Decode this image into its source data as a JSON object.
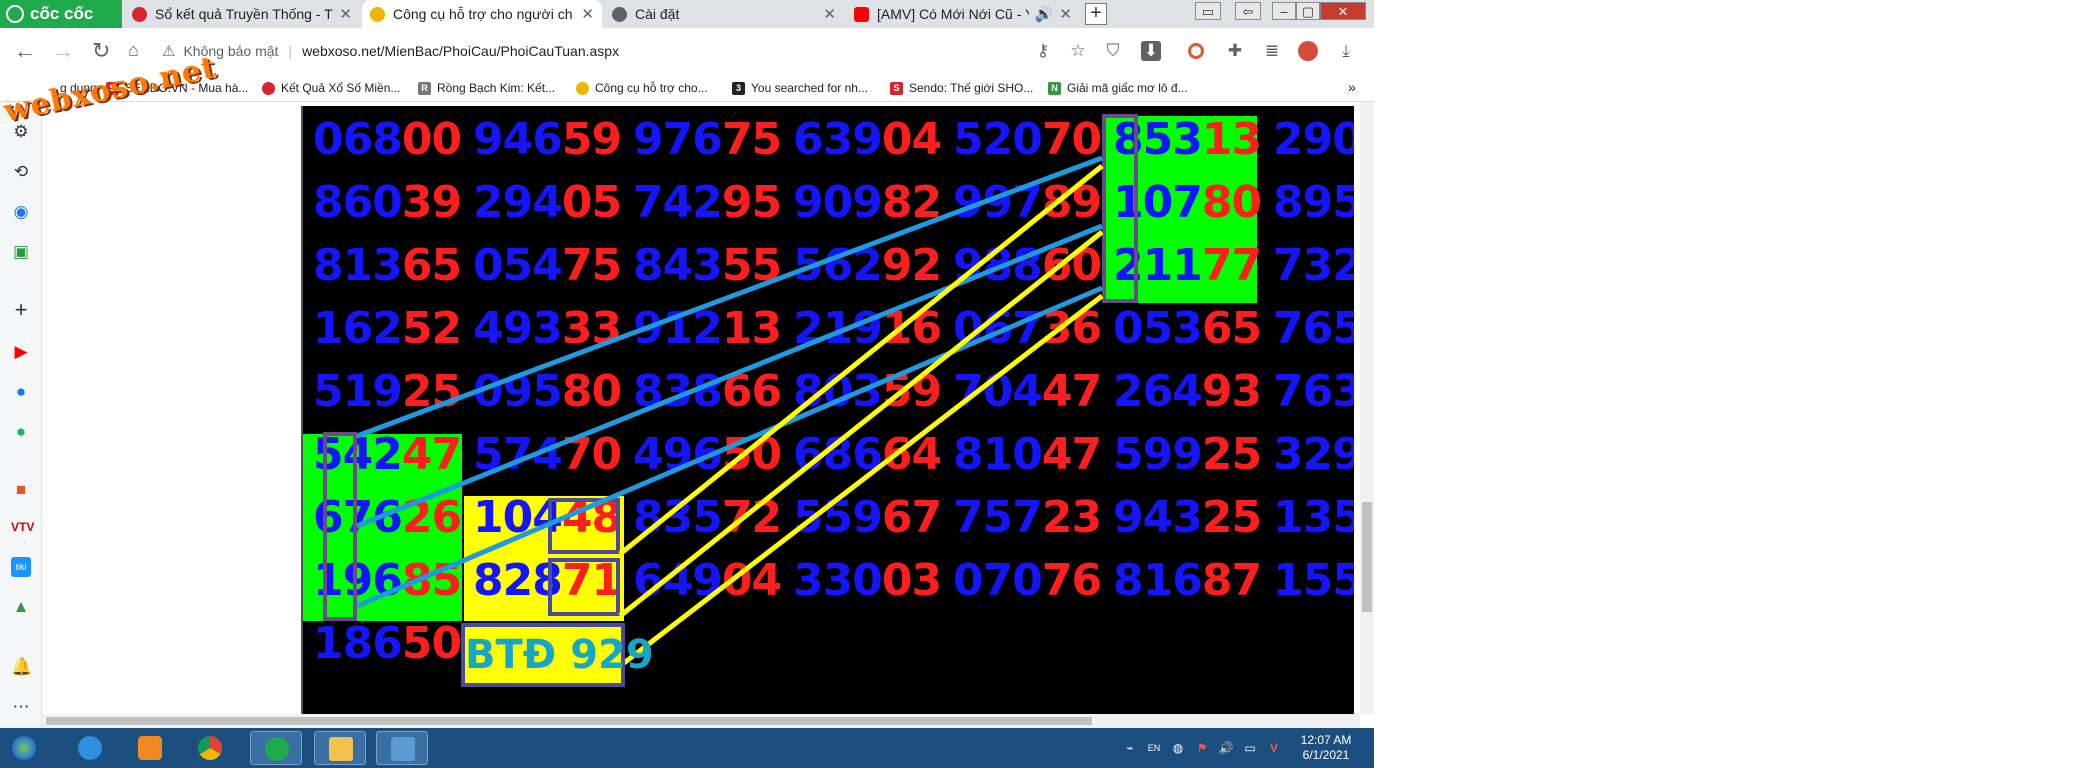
{
  "browser": {
    "brand": "cốc cốc",
    "tabs": [
      {
        "title": "Sổ kết quả Truyền Thống - T",
        "favicon_color": "#d9232d",
        "active": false
      },
      {
        "title": "Công cụ hỗ trợ cho người ch",
        "favicon_color": "#f2b400",
        "active": true
      },
      {
        "title": "Cài đặt",
        "favicon_color": "#5f6368",
        "active": false
      },
      {
        "title": "[AMV] Có Mới Nới Cũ - Y",
        "favicon_color": "#ff0000",
        "active": false
      }
    ],
    "new_tab": "+",
    "window_controls": [
      "▭",
      "⇦",
      "–",
      "▢",
      "✕"
    ],
    "address": {
      "security": "Không bảo mật",
      "url": "webxoso.net/MienBac/PhoiCau/PhoiCauTuan.aspx"
    },
    "bookmarks": [
      {
        "label": "g dụng",
        "icon": "apps-icon",
        "color": "#5f6368"
      },
      {
        "label": "SENDO.VN - Mua hà...",
        "icon": "sendo-icon",
        "color": "#d9232d"
      },
      {
        "label": "Kết Quả Xổ Số Miền...",
        "icon": "xoso-icon",
        "color": "#d9232d"
      },
      {
        "label": "Rồng Bạch Kim: Kết...",
        "icon": "rbk-icon",
        "color": "#777777"
      },
      {
        "label": "Công cụ hỗ trợ cho...",
        "icon": "xs-icon",
        "color": "#f2b400"
      },
      {
        "label": "You searched for nh...",
        "icon": "365-icon",
        "color": "#222222"
      },
      {
        "label": "Sendo: Thế giới SHO...",
        "icon": "sendo-icon",
        "color": "#d9232d"
      },
      {
        "label": "Giải mã giấc mơ lô đ...",
        "icon": "nd-icon",
        "color": "#2e9b3a"
      }
    ],
    "bookmarks_more": "»",
    "watermark": "webxoso.net"
  },
  "grid": {
    "rows": [
      [
        "06800",
        "94659",
        "97675",
        "63904",
        "52070",
        "85313",
        "290"
      ],
      [
        "86039",
        "29405",
        "74295",
        "90982",
        "99789",
        "10780",
        "895"
      ],
      [
        "81365",
        "05475",
        "84355",
        "56292",
        "98860",
        "21177",
        "732"
      ],
      [
        "16252",
        "49333",
        "91213",
        "21916",
        "06736",
        "05365",
        "765"
      ],
      [
        "51925",
        "09580",
        "83866",
        "80359",
        "70447",
        "26493",
        "763"
      ],
      [
        "54247",
        "57470",
        "49650",
        "68664",
        "81047",
        "59925",
        "329"
      ],
      [
        "67626",
        "10448",
        "83572",
        "55967",
        "75723",
        "94325",
        "135"
      ],
      [
        "19685",
        "82871",
        "64904",
        "33003",
        "07076",
        "81687",
        "155"
      ],
      [
        "18650"
      ]
    ],
    "btd_label": "BTĐ 929",
    "colors": {
      "blue": "#1414ff",
      "red": "#ff1e1e",
      "green": "#00ff00",
      "yellow": "#ffff00",
      "cyan_line": "#1e9be0",
      "yellow_line": "#ffff00"
    }
  },
  "taskbar": {
    "time": "12:07 AM",
    "date": "6/1/2021",
    "apps": [
      "start-orb",
      "internet-explorer",
      "media-player",
      "chrome",
      "coccoc",
      "file-explorer",
      "remote-desktop"
    ]
  }
}
